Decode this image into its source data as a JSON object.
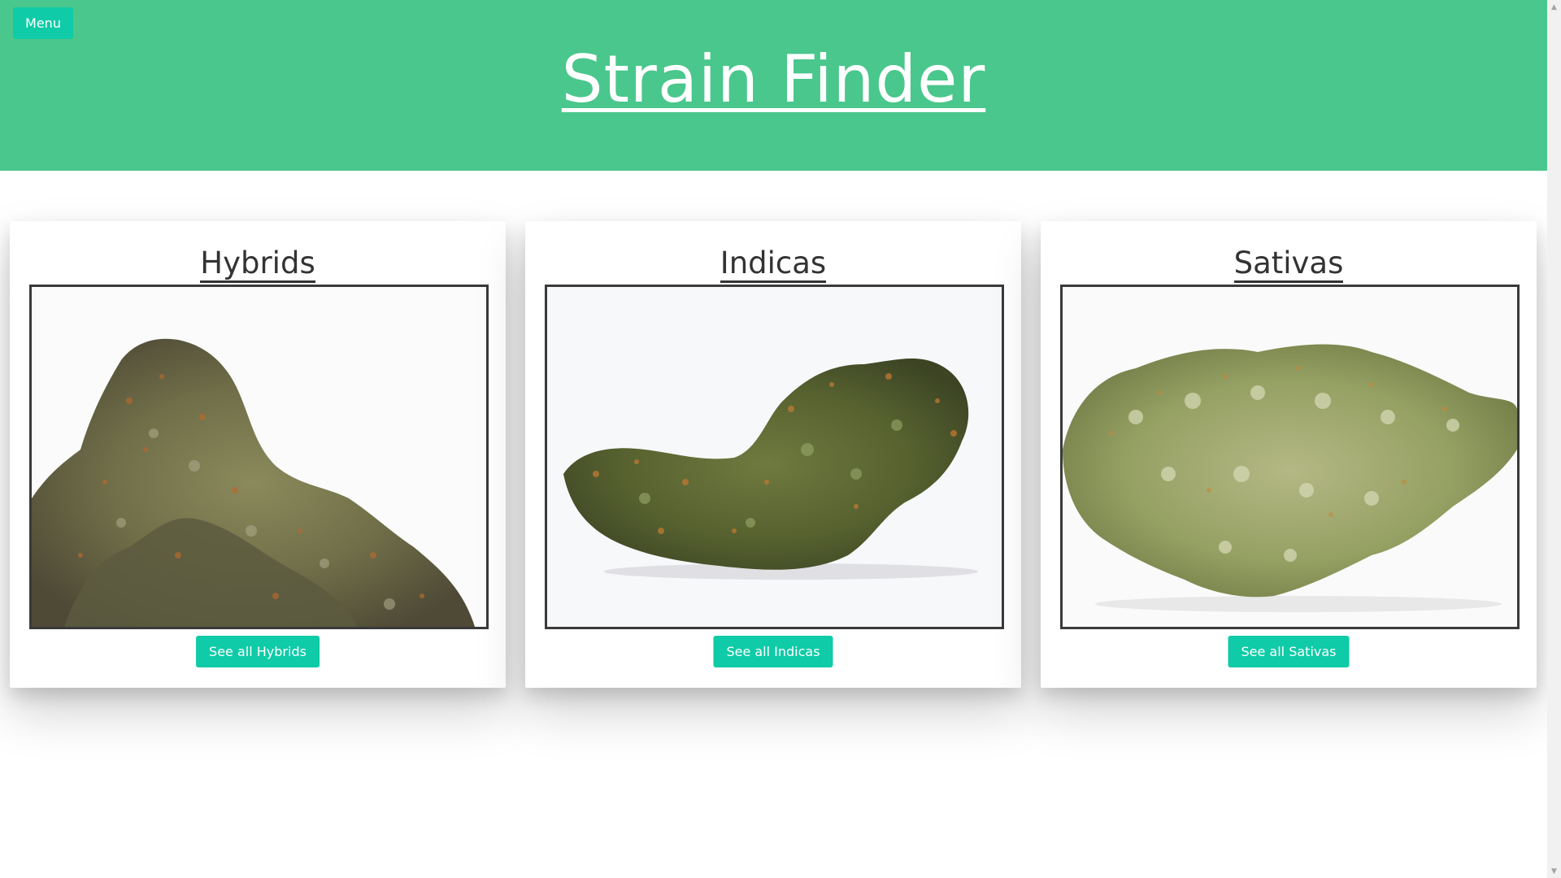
{
  "header": {
    "menu_label": "Menu",
    "title": "Strain Finder",
    "background_color": "#4ac78c"
  },
  "accent_color": "#0fcba7",
  "cards": [
    {
      "title": "Hybrids",
      "image_icon": "cannabis-bud-hybrid-image",
      "button_label": "See all Hybrids"
    },
    {
      "title": "Indicas",
      "image_icon": "cannabis-bud-indica-image",
      "button_label": "See all Indicas"
    },
    {
      "title": "Sativas",
      "image_icon": "cannabis-bud-sativa-image",
      "button_label": "See all Sativas"
    }
  ],
  "scrollbar": {
    "up_icon": "scroll-up-arrow-icon",
    "down_icon": "scroll-down-arrow-icon"
  }
}
